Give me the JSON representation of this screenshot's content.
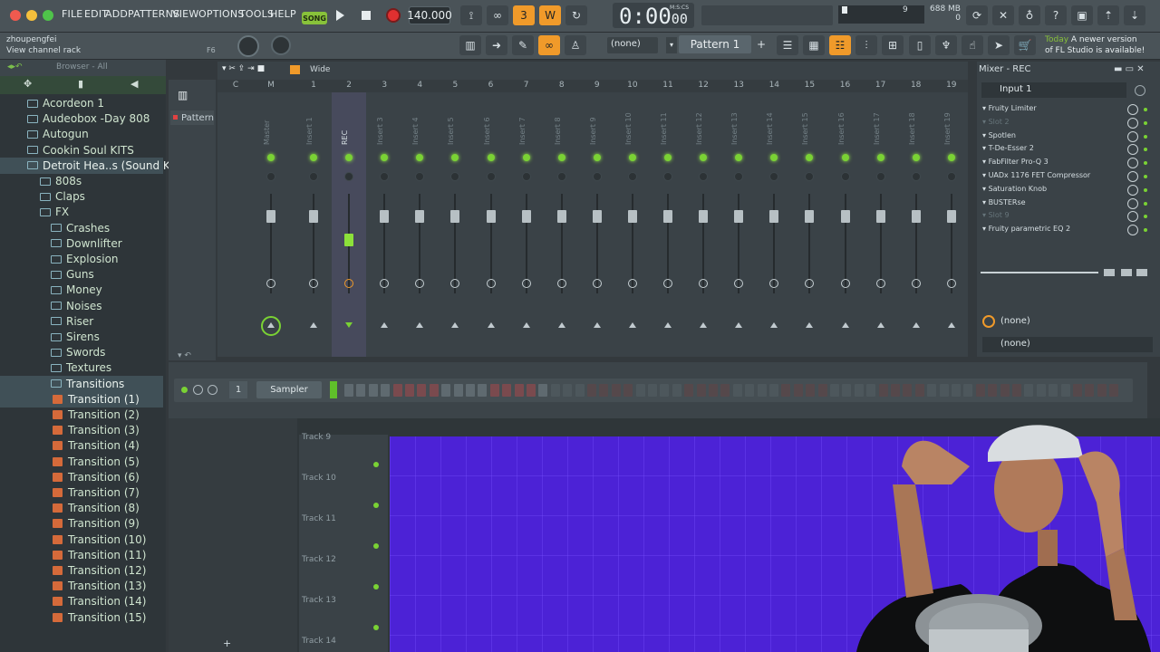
{
  "menu": [
    "FILE",
    "EDIT",
    "ADD",
    "PATTERNS",
    "VIEW",
    "OPTIONS",
    "TOOLS",
    "HELP"
  ],
  "transport": {
    "mode": "SONG",
    "tempo": "140.000",
    "time_main": "0:00",
    "time_ms": "00",
    "time_unit": "M:S:CS",
    "cpu_value": "9",
    "memory": "688 MB",
    "memory_sub": "0"
  },
  "hint": {
    "line1": "zhoupengfei",
    "line2": "View channel rack",
    "shortcut": "F6"
  },
  "toolbar2": {
    "none_label": "(none)",
    "pattern_label": "Pattern 1",
    "news_line1_hl": "Today",
    "news_line1": "A newer version",
    "news_line2": "of FL Studio is available!"
  },
  "browser": {
    "title": "Browser - All",
    "items": [
      {
        "label": "Acordeon 1",
        "indent": 1,
        "type": "folder",
        "selected": false
      },
      {
        "label": "Audeobox -Day 808",
        "indent": 1,
        "type": "folder",
        "selected": false
      },
      {
        "label": "Autogun",
        "indent": 1,
        "type": "folder",
        "selected": false
      },
      {
        "label": "Cookin Soul KITS",
        "indent": 1,
        "type": "folder",
        "selected": false
      },
      {
        "label": "Detroit Hea..s (Sound Kit)",
        "indent": 1,
        "type": "folder",
        "selected": true
      },
      {
        "label": "808s",
        "indent": 2,
        "type": "folder",
        "selected": false
      },
      {
        "label": "Claps",
        "indent": 2,
        "type": "folder",
        "selected": false
      },
      {
        "label": "FX",
        "indent": 2,
        "type": "folder",
        "selected": false
      },
      {
        "label": "Crashes",
        "indent": 3,
        "type": "folder",
        "selected": false
      },
      {
        "label": "Downlifter",
        "indent": 3,
        "type": "folder",
        "selected": false
      },
      {
        "label": "Explosion",
        "indent": 3,
        "type": "folder",
        "selected": false
      },
      {
        "label": "Guns",
        "indent": 3,
        "type": "folder",
        "selected": false
      },
      {
        "label": "Money",
        "indent": 3,
        "type": "folder",
        "selected": false
      },
      {
        "label": "Noises",
        "indent": 3,
        "type": "folder",
        "selected": false
      },
      {
        "label": "Riser",
        "indent": 3,
        "type": "folder",
        "selected": false
      },
      {
        "label": "Sirens",
        "indent": 3,
        "type": "folder",
        "selected": false
      },
      {
        "label": "Swords",
        "indent": 3,
        "type": "folder",
        "selected": false
      },
      {
        "label": "Textures",
        "indent": 3,
        "type": "folder",
        "selected": false
      },
      {
        "label": "Transitions",
        "indent": 3,
        "type": "folder",
        "selected": true
      },
      {
        "label": "Transition  (1)",
        "indent": 4,
        "type": "wave",
        "selected": true
      },
      {
        "label": "Transition  (2)",
        "indent": 4,
        "type": "wave",
        "selected": false
      },
      {
        "label": "Transition  (3)",
        "indent": 4,
        "type": "wave",
        "selected": false
      },
      {
        "label": "Transition  (4)",
        "indent": 4,
        "type": "wave",
        "selected": false
      },
      {
        "label": "Transition  (5)",
        "indent": 4,
        "type": "wave",
        "selected": false
      },
      {
        "label": "Transition  (6)",
        "indent": 4,
        "type": "wave",
        "selected": false
      },
      {
        "label": "Transition  (7)",
        "indent": 4,
        "type": "wave",
        "selected": false
      },
      {
        "label": "Transition  (8)",
        "indent": 4,
        "type": "wave",
        "selected": false
      },
      {
        "label": "Transition  (9)",
        "indent": 4,
        "type": "wave",
        "selected": false
      },
      {
        "label": "Transition  (10)",
        "indent": 4,
        "type": "wave",
        "selected": false
      },
      {
        "label": "Transition  (11)",
        "indent": 4,
        "type": "wave",
        "selected": false
      },
      {
        "label": "Transition  (12)",
        "indent": 4,
        "type": "wave",
        "selected": false
      },
      {
        "label": "Transition  (13)",
        "indent": 4,
        "type": "wave",
        "selected": false
      },
      {
        "label": "Transition  (14)",
        "indent": 4,
        "type": "wave",
        "selected": false
      },
      {
        "label": "Transition  (15)",
        "indent": 4,
        "type": "wave",
        "selected": false
      }
    ]
  },
  "pattern_tab": "Pattern",
  "mixer": {
    "view_label": "Wide",
    "ruler": [
      "C",
      "M",
      "1",
      "2",
      "3",
      "4",
      "5",
      "6",
      "7",
      "8",
      "9",
      "10",
      "11",
      "12",
      "13",
      "14",
      "15",
      "16",
      "17",
      "18",
      "19"
    ],
    "strips": [
      "Master",
      "Insert 1",
      "REC",
      "Insert 3",
      "Insert 4",
      "Insert 5",
      "Insert 6",
      "Insert 7",
      "Insert 8",
      "Insert 9",
      "Insert 10",
      "Insert 11",
      "Insert 12",
      "Insert 13",
      "Insert 14",
      "Insert 15",
      "Insert 16",
      "Insert 17",
      "Insert 18",
      "Insert 19"
    ]
  },
  "mixer_panel": {
    "title": "Mixer - REC",
    "input": "Input 1",
    "effects": [
      {
        "name": "Fruity Limiter",
        "empty": false
      },
      {
        "name": "Slot 2",
        "empty": true
      },
      {
        "name": "Spotlen",
        "empty": false
      },
      {
        "name": "T-De-Esser 2",
        "empty": false
      },
      {
        "name": "FabFilter Pro-Q 3",
        "empty": false
      },
      {
        "name": "UADx 1176 FET Compressor",
        "empty": false
      },
      {
        "name": "Saturation Knob",
        "empty": false
      },
      {
        "name": "BUSTERse",
        "empty": false
      },
      {
        "name": "Slot 9",
        "empty": true
      },
      {
        "name": "Fruity parametric EQ 2",
        "empty": false
      }
    ],
    "out1": "(none)",
    "out2": "(none)"
  },
  "rack": {
    "channel_number": "1",
    "instrument": "Sampler",
    "steps": 64
  },
  "playlist": {
    "tracks": [
      "Track 9",
      "Track 10",
      "Track 11",
      "Track 12",
      "Track 13",
      "Track 14"
    ]
  },
  "colors": {
    "accent_green": "#7ad234",
    "accent_orange": "#f09a2a",
    "playlist_bg": "#4c22d6",
    "record_red": "#e03030"
  }
}
